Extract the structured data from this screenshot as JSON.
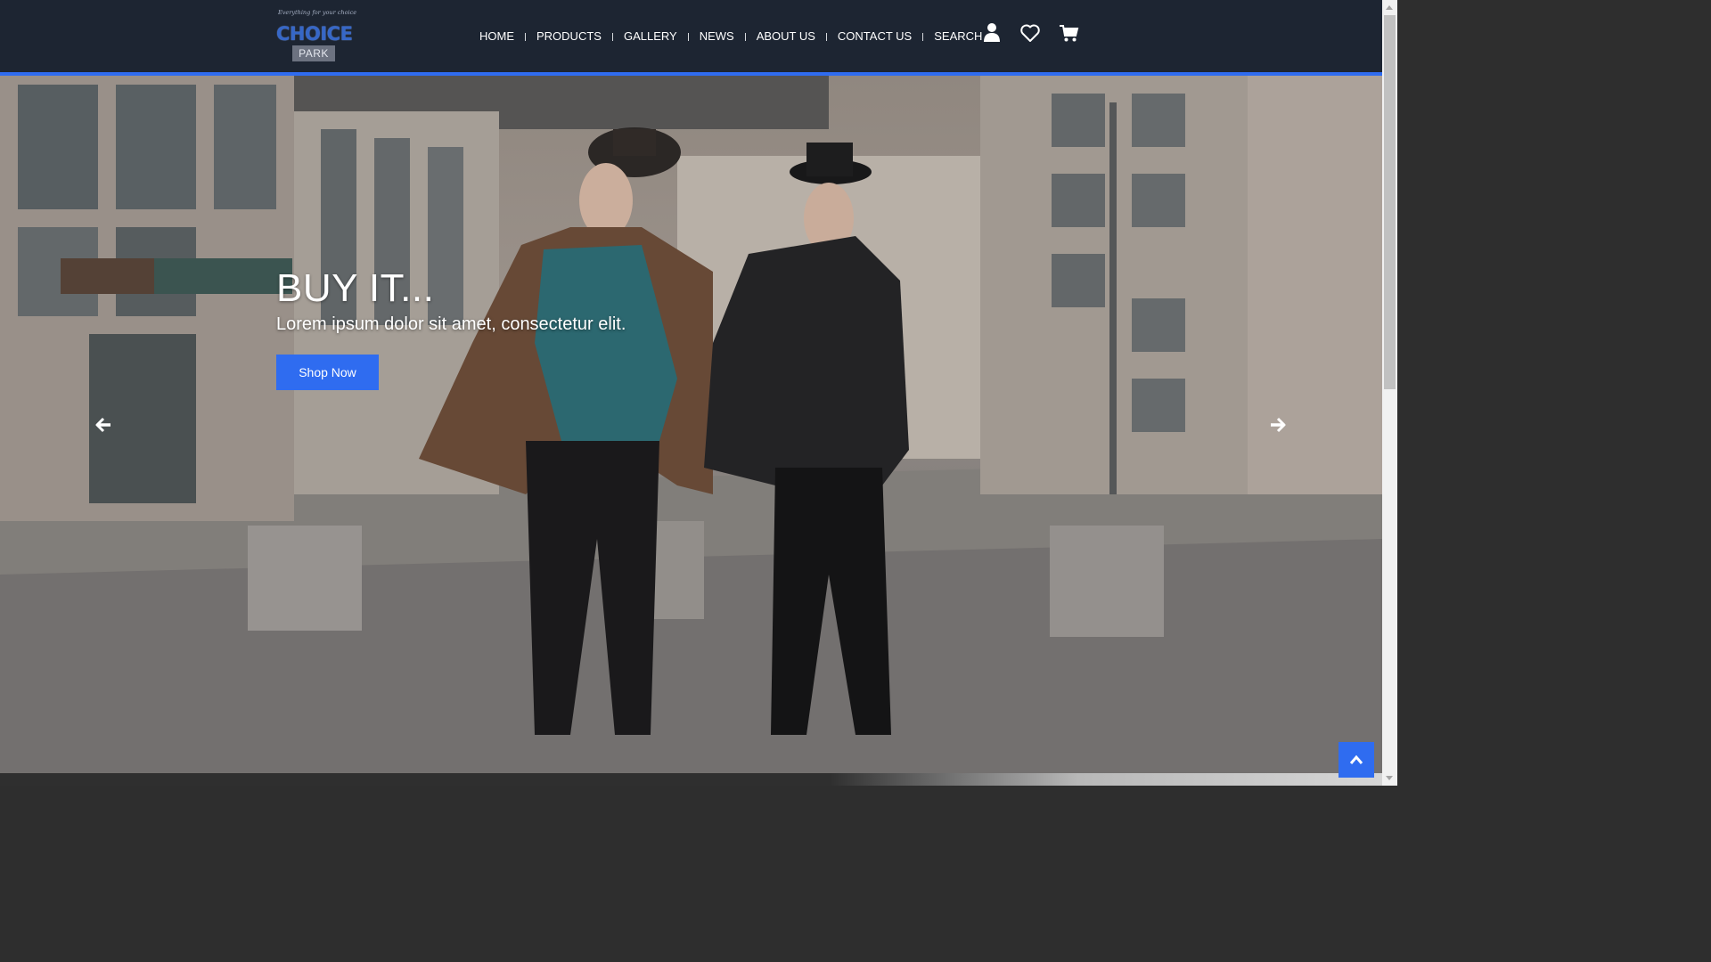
{
  "brand": {
    "tagline": "Everything for your choice",
    "logo_word_1": "CHOICE",
    "logo_word_2": "PARK"
  },
  "nav": {
    "items": [
      {
        "label": "HOME"
      },
      {
        "label": "PRODUCTS"
      },
      {
        "label": "GALLERY"
      },
      {
        "label": "NEWS"
      },
      {
        "label": "ABOUT US"
      },
      {
        "label": "CONTACT US"
      },
      {
        "label": "SEARCH"
      }
    ]
  },
  "header_icons": [
    "user-icon",
    "heart-icon",
    "cart-icon"
  ],
  "hero": {
    "title": "BUY IT...",
    "subtitle": "Lorem ipsum dolor sit amet, consectetur elit.",
    "button_label": "Shop Now",
    "prev_icon": "arrow-left-icon",
    "next_icon": "arrow-right-icon"
  },
  "colors": {
    "header_bg": "#1d2532",
    "accent": "#2f6cf0",
    "nav_text": "#ffffff"
  },
  "back_to_top_icon": "chevron-up-icon"
}
